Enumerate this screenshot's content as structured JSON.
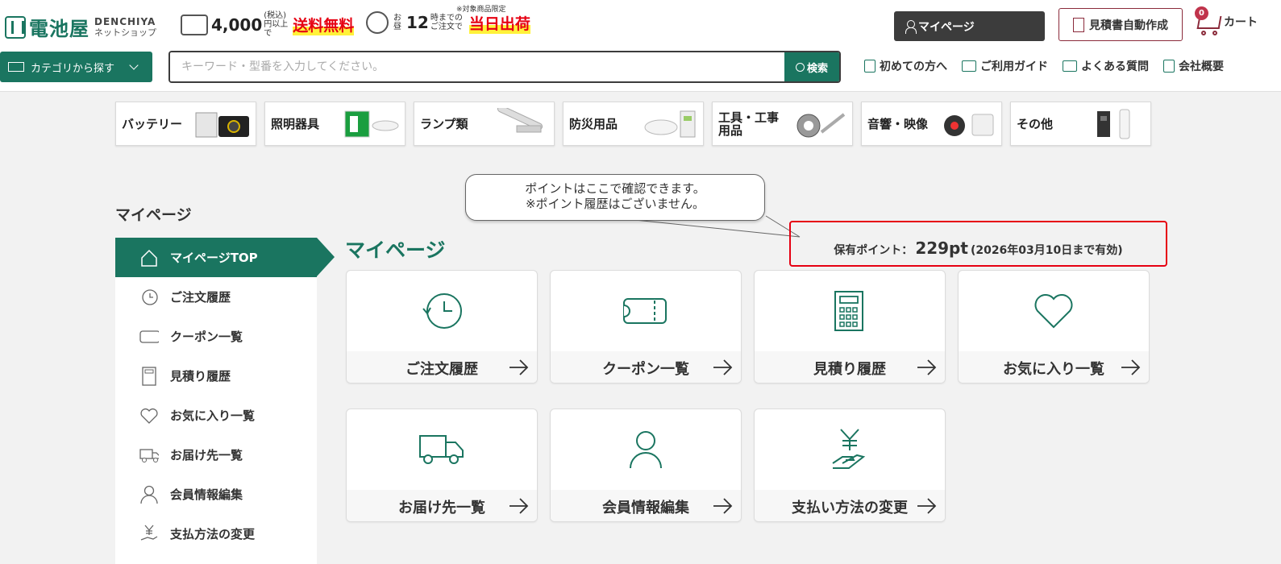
{
  "header": {
    "logo_main": "電池屋",
    "logo_en": "DENCHIYA",
    "logo_sub": "ネットショップ",
    "promo1_num": "4,000",
    "promo1_small": "(税込) 円以上で",
    "promo1_red": "送料無料",
    "promo2_small1": "お昼",
    "promo2_num": "12",
    "promo2_small2": "時までの ご注文で",
    "promo2_red": "当日出荷",
    "promo2_note": "※対象商品限定",
    "mypage_label": "マイページ",
    "estimate_label": "見積書自動作成",
    "cart_label": "カート",
    "cart_count": "0",
    "category_button": "カテゴリから探す",
    "search_placeholder": "キーワード・型番を入力してください。",
    "search_button": "検索",
    "links": [
      "初めての方へ",
      "ご利用ガイド",
      "よくある質問",
      "会社概要"
    ]
  },
  "categories": [
    "バッテリー",
    "照明器具",
    "ランプ類",
    "防災用品",
    "工具・工事用品",
    "音響・映像",
    "その他"
  ],
  "sidebar": {
    "title": "マイページ",
    "items": [
      "マイページTOP",
      "ご注文履歴",
      "クーポン一覧",
      "見積り履歴",
      "お気に入り一覧",
      "お届け先一覧",
      "会員情報編集",
      "支払方法の変更"
    ]
  },
  "main": {
    "title": "マイページ",
    "points_label": "保有ポイント：",
    "points_value": "229pt",
    "points_expiry": "(2026年03月10日まで有効)",
    "callout_line1": "ポイントはここで確認できます。",
    "callout_line2": "※ポイント履歴はございません。",
    "cards": [
      "ご注文履歴",
      "クーポン一覧",
      "見積り履歴",
      "お気に入り一覧",
      "お届け先一覧",
      "会員情報編集",
      "支払い方法の変更"
    ]
  },
  "colors": {
    "brand_green": "#1a7560",
    "accent_red": "#e60012",
    "dark": "#3c3c3c"
  }
}
